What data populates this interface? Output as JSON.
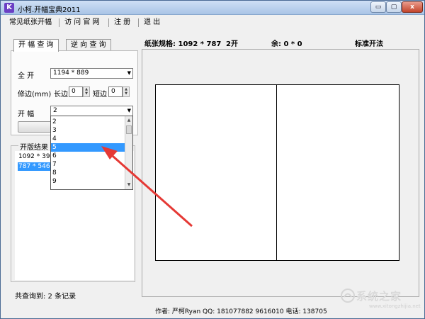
{
  "window": {
    "title": "小柯.开幅宝典2011",
    "min_label": "▭",
    "max_label": "▢",
    "close_label": "x",
    "app_icon_letter": "K"
  },
  "menu": {
    "items": [
      "常见纸张开幅",
      "访 问 官 网",
      "注  册",
      "退  出"
    ]
  },
  "tabs": [
    "开 幅 查 询",
    "逆 向 查 询"
  ],
  "form": {
    "full_label": "全    开",
    "full_value": "1194 * 889",
    "trim_label": "修边(mm)",
    "long_label": "长边",
    "long_value": "0",
    "short_label": "短边",
    "short_value": "0",
    "kai_label": "开    幅",
    "kai_value": "2"
  },
  "dropdown": {
    "options": [
      "2",
      "3",
      "4",
      "5",
      "6",
      "7",
      "8",
      "9"
    ],
    "selected": "5"
  },
  "results": {
    "group_title": "开版结果（",
    "rows": [
      "1092 * 393",
      "787 * 546"
    ],
    "selected": "787 * 546"
  },
  "status": {
    "count_text": "共查询到: 2 条记录"
  },
  "info": {
    "paper_size": "纸张规格: 1092 * 787",
    "kai": "2开",
    "remainder": "余: 0 * 0",
    "method": "标准开法"
  },
  "footer": {
    "text": "作者: 严柯Ryan QQ: 181077882 9616010 电话: 138705"
  },
  "watermark": {
    "text": "系统之家",
    "url": "www.xitongzhijia.net"
  },
  "colors": {
    "selection": "#3399ff",
    "arrow": "#e53935"
  }
}
